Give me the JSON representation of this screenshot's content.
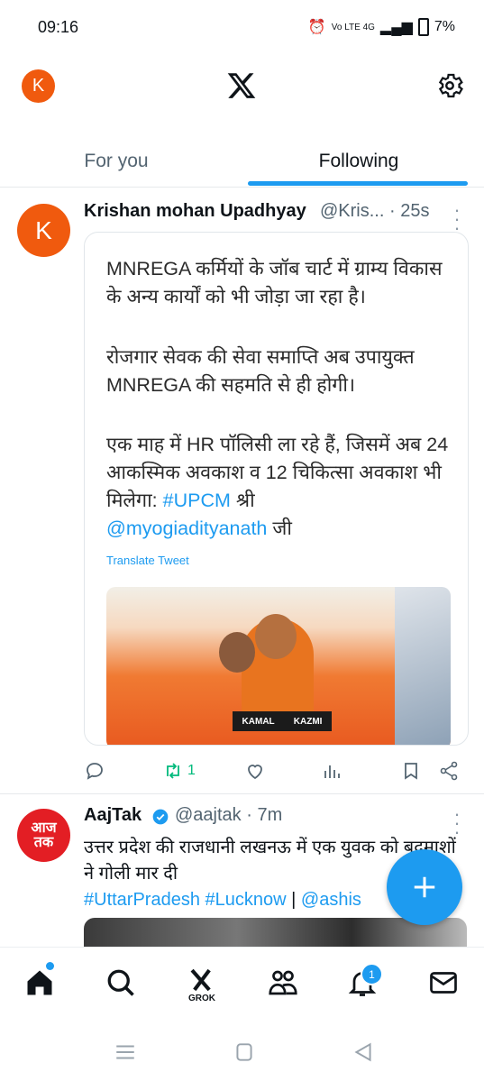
{
  "status_bar": {
    "time": "09:16",
    "network": "Vo LTE 4G",
    "battery": "7%"
  },
  "header": {
    "avatar_letter": "K"
  },
  "tabs": [
    {
      "label": "For you"
    },
    {
      "label": "Following"
    }
  ],
  "tweet1": {
    "avatar_letter": "K",
    "name": "Krishan mohan Upadhyay",
    "handle": "@Kris...",
    "time": "· 25s",
    "embed": {
      "para1": "MNREGA कर्मियों के जॉब चार्ट में ग्राम्य विकास के अन्य कार्यों को भी जोड़ा जा रहा है।",
      "para2": "रोजगार सेवक की सेवा समाप्ति अब उपायुक्त MNREGA की सहमति से ही होगी।",
      "para3_text": "एक माह में HR पॉलिसी ला रहे हैं, जिसमें अब 24 आकस्मिक अवकाश व 12 चिकित्सा अवकाश भी मिलेगा: ",
      "para3_hashtag": "#UPCM",
      "para3_shri": " श्री",
      "para3_mention": "@myogiadityanath",
      "para3_ji": " जी",
      "translate": "Translate Tweet",
      "photo_sign_left": "KAMAL",
      "photo_sign_right": "KAZMI"
    },
    "actions": {
      "retweets": "1"
    }
  },
  "tweet2": {
    "avatar_text": "आज तक",
    "name": "AajTak",
    "handle": "@aajtak · 7m",
    "text": "उत्तर प्रदेश की राजधानी लखनऊ में एक युवक को बदमाशों ने गोली मार दी",
    "hashtags": "#UttarPradesh #Lucknow",
    "separator": " | ",
    "mention": "@ashis"
  },
  "fab": {
    "icon": "plus-icon"
  },
  "bottom_nav": {
    "grok_label": "GROK",
    "notifications_badge": "1"
  },
  "colors": {
    "accent": "#1d9bf0",
    "avatar": "#f05a0e",
    "aajtak_red": "#e31e24",
    "retweet_green": "#00ba7c"
  }
}
